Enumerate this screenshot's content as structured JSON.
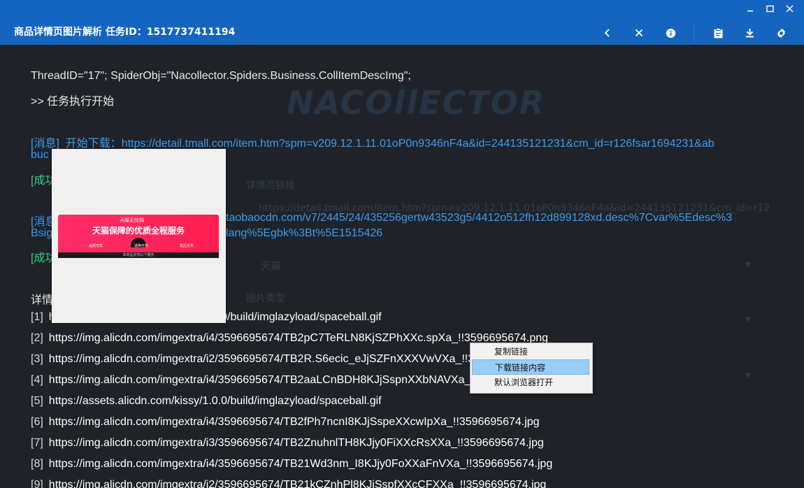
{
  "window": {
    "title": "商品详情页图片解析 任务ID：1517737411194",
    "controls": [
      "minimize-icon",
      "maximize-icon",
      "close-icon"
    ]
  },
  "toolbar": {
    "icons": [
      "back-icon",
      "stop-icon",
      "info-icon",
      "clipboard-icon",
      "download-icon",
      "settings-icon"
    ]
  },
  "watermark": "NACOllECTOR",
  "log": {
    "thread_line": "ThreadID=\"17\"; SpiderObj=\"Nacollector.Spiders.Business.CollItemDescImg\";",
    "start_line": ">> 任务执行开始",
    "msg1_prefix": "[消息]",
    "msg1_text": "开始下载：https://detail.tmall.com/item.htm?spm=v209.12.1.11.01oP0n9346nF4a&id=244135121231&cm_id=r126fsar1694231&ab",
    "msg1_cont": "buc",
    "succ1": "[成功",
    "msg2_prefix": "[消息",
    "msg2_text": "taobaocdn.com/v7/2445/24/435256gertw43523g5/4412o512fh12d899128xd.desc%7Cvar%5Edesc%3",
    "msg2_cont_a": "Bsig",
    "msg2_cont_b": "lang%5Egbk%3Bt%5E1515426",
    "succ2": "[成功",
    "detail_label": "详情"
  },
  "ghost": {
    "field1_label": "详情页链接",
    "field1_value": "https://detail.tmall.com/item.htm?spm=v209.12.1.11.01oP0n9346nF4a&id=244135121231&cm_id=r12",
    "field2_value": "天猫",
    "field3_label": "图片类型"
  },
  "urls": [
    {
      "idx": "[1]",
      "url": "https://assets.alicdn.com/kissy/1.0.0/build/imglazyload/spaceball.gif"
    },
    {
      "idx": "[2]",
      "url": "https://img.alicdn.com/imgextra/i4/3596695674/TB2pC7TeRLN8KjSZPhXXc.spXa_!!3596695674.png"
    },
    {
      "idx": "[3]",
      "url": "https://img.alicdn.com/imgextra/i2/3596695674/TB2R.S6ecic_eJjSZFnXXXVwVXa_!!3596695674.jpg"
    },
    {
      "idx": "[4]",
      "url": "https://img.alicdn.com/imgextra/i4/3596695674/TB2aaLCnBDH8KJjSspnXXbNAVXa_!!3596695674.jpg"
    },
    {
      "idx": "[5]",
      "url": "https://assets.alicdn.com/kissy/1.0.0/build/imglazyload/spaceball.gif"
    },
    {
      "idx": "[6]",
      "url": "https://img.alicdn.com/imgextra/i4/3596695674/TB2fPh7ncnI8KJjSspeXXcwIpXa_!!3596695674.jpg"
    },
    {
      "idx": "[7]",
      "url": "https://img.alicdn.com/imgextra/i3/3596695674/TB2ZnuhnlTH8KJjy0FiXXcRsXXa_!!3596695674.jpg"
    },
    {
      "idx": "[8]",
      "url": "https://img.alicdn.com/imgextra/i4/3596695674/TB21Wd3nm_I8KJjy0FoXXaFnVXa_!!3596695674.jpg"
    },
    {
      "idx": "[9]",
      "url": "https://img.alicdn.com/imgextra/i2/3596695674/TB21kCZnhPl8KJjSspfXXcCFXXa_!!3596695674.jpg"
    }
  ],
  "preview": {
    "logo_text": "天猫无忧购",
    "title": "天猫保障的优质全程服务",
    "tags": [
      "运费无忧",
      "退换无忧",
      "售后无忧"
    ],
    "footer": "本商品支持以下服务"
  },
  "context_menu": {
    "items": [
      {
        "label": "复制链接",
        "active": false
      },
      {
        "label": "下载链接内容",
        "active": true
      },
      {
        "label": "默认浏览器打开",
        "active": false
      }
    ]
  },
  "colors": {
    "titlebar": "#1565c0",
    "background": "#1f2329",
    "message": "#3a9bf0",
    "success": "#35d07f",
    "menu_highlight": "#99ccf7"
  }
}
